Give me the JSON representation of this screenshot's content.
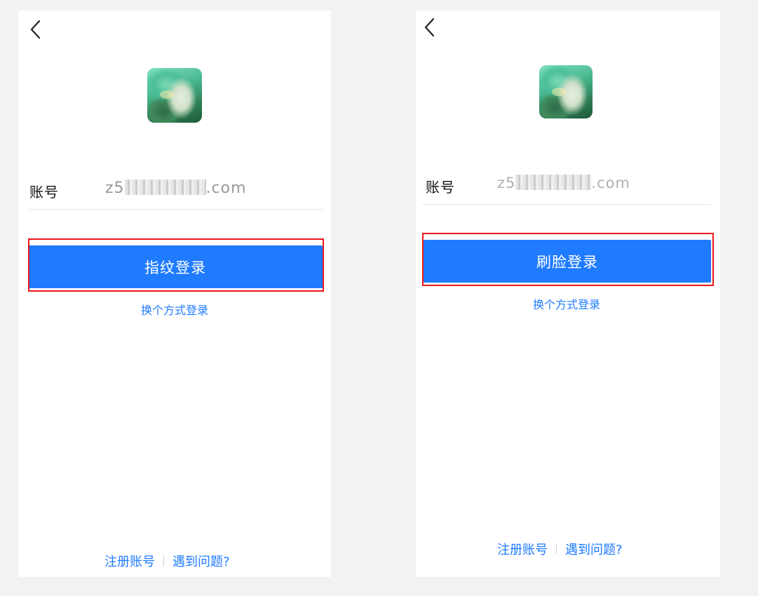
{
  "screens": [
    {
      "back_icon": "chevron-left-icon",
      "avatar_icon": "user-avatar",
      "account_label": "账号",
      "account_value_prefix": "z5",
      "account_value_suffix": ".com",
      "login_button_label": "指纹登录",
      "switch_method_label": "换个方式登录",
      "register_label": "注册账号",
      "help_label": "遇到问题?"
    },
    {
      "back_icon": "chevron-left-icon",
      "avatar_icon": "user-avatar",
      "account_label": "账号",
      "account_value_prefix": "z5",
      "account_value_suffix": ".com",
      "login_button_label": "刷脸登录",
      "switch_method_label": "换个方式登录",
      "register_label": "注册账号",
      "help_label": "遇到问题?"
    }
  ],
  "colors": {
    "page_background": "#f2f2f2",
    "primary_blue": "#1f7bff",
    "highlight_red": "#e8161c",
    "placeholder_gray": "#9a9a9a"
  }
}
